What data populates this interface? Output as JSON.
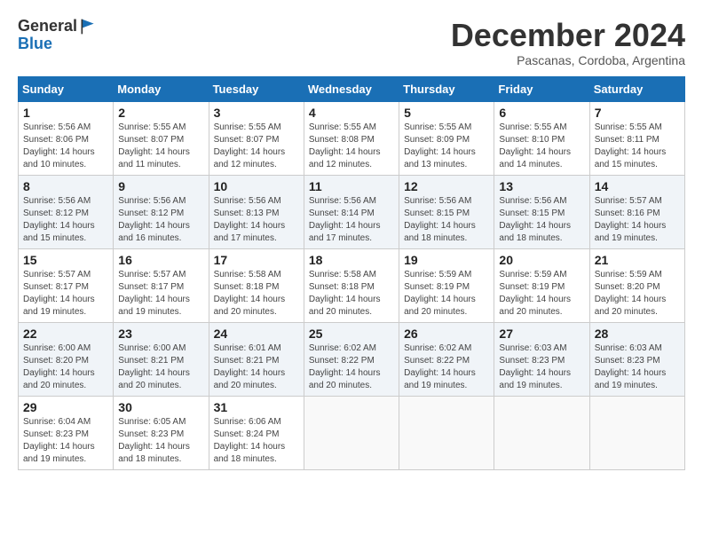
{
  "logo": {
    "general": "General",
    "blue": "Blue"
  },
  "title": "December 2024",
  "subtitle": "Pascanas, Cordoba, Argentina",
  "days_header": [
    "Sunday",
    "Monday",
    "Tuesday",
    "Wednesday",
    "Thursday",
    "Friday",
    "Saturday"
  ],
  "weeks": [
    [
      {
        "day": "1",
        "info": "Sunrise: 5:56 AM\nSunset: 8:06 PM\nDaylight: 14 hours\nand 10 minutes."
      },
      {
        "day": "2",
        "info": "Sunrise: 5:55 AM\nSunset: 8:07 PM\nDaylight: 14 hours\nand 11 minutes."
      },
      {
        "day": "3",
        "info": "Sunrise: 5:55 AM\nSunset: 8:07 PM\nDaylight: 14 hours\nand 12 minutes."
      },
      {
        "day": "4",
        "info": "Sunrise: 5:55 AM\nSunset: 8:08 PM\nDaylight: 14 hours\nand 12 minutes."
      },
      {
        "day": "5",
        "info": "Sunrise: 5:55 AM\nSunset: 8:09 PM\nDaylight: 14 hours\nand 13 minutes."
      },
      {
        "day": "6",
        "info": "Sunrise: 5:55 AM\nSunset: 8:10 PM\nDaylight: 14 hours\nand 14 minutes."
      },
      {
        "day": "7",
        "info": "Sunrise: 5:55 AM\nSunset: 8:11 PM\nDaylight: 14 hours\nand 15 minutes."
      }
    ],
    [
      {
        "day": "8",
        "info": "Sunrise: 5:56 AM\nSunset: 8:12 PM\nDaylight: 14 hours\nand 15 minutes."
      },
      {
        "day": "9",
        "info": "Sunrise: 5:56 AM\nSunset: 8:12 PM\nDaylight: 14 hours\nand 16 minutes."
      },
      {
        "day": "10",
        "info": "Sunrise: 5:56 AM\nSunset: 8:13 PM\nDaylight: 14 hours\nand 17 minutes."
      },
      {
        "day": "11",
        "info": "Sunrise: 5:56 AM\nSunset: 8:14 PM\nDaylight: 14 hours\nand 17 minutes."
      },
      {
        "day": "12",
        "info": "Sunrise: 5:56 AM\nSunset: 8:15 PM\nDaylight: 14 hours\nand 18 minutes."
      },
      {
        "day": "13",
        "info": "Sunrise: 5:56 AM\nSunset: 8:15 PM\nDaylight: 14 hours\nand 18 minutes."
      },
      {
        "day": "14",
        "info": "Sunrise: 5:57 AM\nSunset: 8:16 PM\nDaylight: 14 hours\nand 19 minutes."
      }
    ],
    [
      {
        "day": "15",
        "info": "Sunrise: 5:57 AM\nSunset: 8:17 PM\nDaylight: 14 hours\nand 19 minutes."
      },
      {
        "day": "16",
        "info": "Sunrise: 5:57 AM\nSunset: 8:17 PM\nDaylight: 14 hours\nand 19 minutes."
      },
      {
        "day": "17",
        "info": "Sunrise: 5:58 AM\nSunset: 8:18 PM\nDaylight: 14 hours\nand 20 minutes."
      },
      {
        "day": "18",
        "info": "Sunrise: 5:58 AM\nSunset: 8:18 PM\nDaylight: 14 hours\nand 20 minutes."
      },
      {
        "day": "19",
        "info": "Sunrise: 5:59 AM\nSunset: 8:19 PM\nDaylight: 14 hours\nand 20 minutes."
      },
      {
        "day": "20",
        "info": "Sunrise: 5:59 AM\nSunset: 8:19 PM\nDaylight: 14 hours\nand 20 minutes."
      },
      {
        "day": "21",
        "info": "Sunrise: 5:59 AM\nSunset: 8:20 PM\nDaylight: 14 hours\nand 20 minutes."
      }
    ],
    [
      {
        "day": "22",
        "info": "Sunrise: 6:00 AM\nSunset: 8:20 PM\nDaylight: 14 hours\nand 20 minutes."
      },
      {
        "day": "23",
        "info": "Sunrise: 6:00 AM\nSunset: 8:21 PM\nDaylight: 14 hours\nand 20 minutes."
      },
      {
        "day": "24",
        "info": "Sunrise: 6:01 AM\nSunset: 8:21 PM\nDaylight: 14 hours\nand 20 minutes."
      },
      {
        "day": "25",
        "info": "Sunrise: 6:02 AM\nSunset: 8:22 PM\nDaylight: 14 hours\nand 20 minutes."
      },
      {
        "day": "26",
        "info": "Sunrise: 6:02 AM\nSunset: 8:22 PM\nDaylight: 14 hours\nand 19 minutes."
      },
      {
        "day": "27",
        "info": "Sunrise: 6:03 AM\nSunset: 8:23 PM\nDaylight: 14 hours\nand 19 minutes."
      },
      {
        "day": "28",
        "info": "Sunrise: 6:03 AM\nSunset: 8:23 PM\nDaylight: 14 hours\nand 19 minutes."
      }
    ],
    [
      {
        "day": "29",
        "info": "Sunrise: 6:04 AM\nSunset: 8:23 PM\nDaylight: 14 hours\nand 19 minutes."
      },
      {
        "day": "30",
        "info": "Sunrise: 6:05 AM\nSunset: 8:23 PM\nDaylight: 14 hours\nand 18 minutes."
      },
      {
        "day": "31",
        "info": "Sunrise: 6:06 AM\nSunset: 8:24 PM\nDaylight: 14 hours\nand 18 minutes."
      },
      {
        "day": "",
        "info": ""
      },
      {
        "day": "",
        "info": ""
      },
      {
        "day": "",
        "info": ""
      },
      {
        "day": "",
        "info": ""
      }
    ]
  ]
}
